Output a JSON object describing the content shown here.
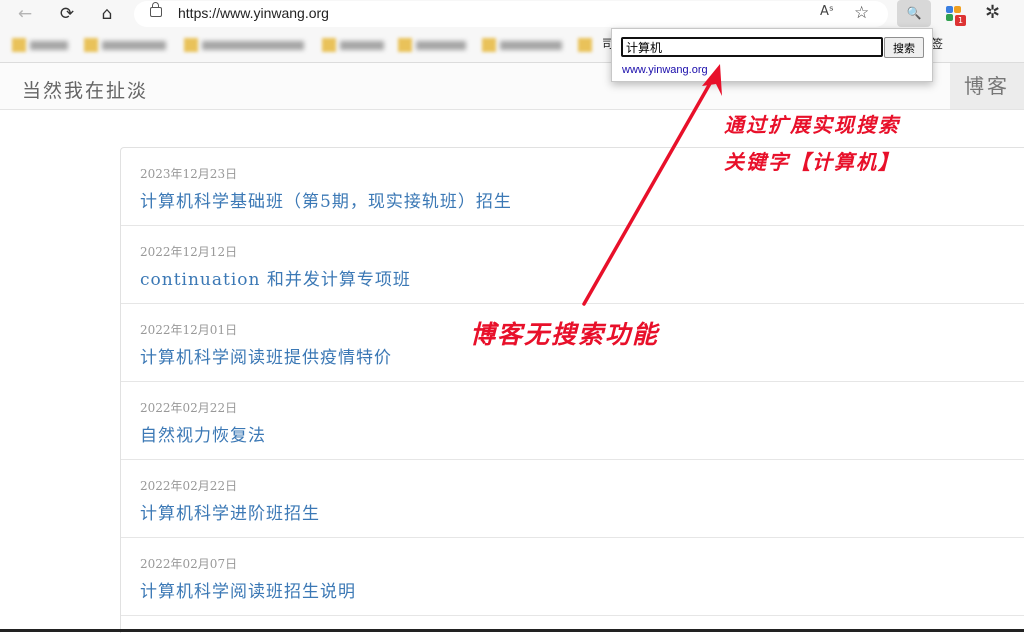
{
  "browser": {
    "url": "https://www.yinwang.org",
    "back_icon": "←",
    "refresh_icon": "⟳",
    "home_icon": "⌂",
    "read_aloud_icon": "Aˢ",
    "favorite_icon": "☆",
    "extension_badge_count": "1",
    "extensions_icon": "✲",
    "search_ext_icon": "🔍",
    "bookmark_tail_1": "司",
    "bookmark_tail_2": "签"
  },
  "search_popup": {
    "input_value": "计算机",
    "button_label": "搜索",
    "result_link": "www.yinwang.org"
  },
  "site": {
    "title": "当然我在扯淡",
    "tab_blog": "博客"
  },
  "posts": [
    {
      "date": "2023年12月23日",
      "title": "计算机科学基础班（第5期，现实接轨班）招生"
    },
    {
      "date": "2022年12月12日",
      "title": "continuation 和并发计算专项班"
    },
    {
      "date": "2022年12月01日",
      "title": "计算机科学阅读班提供疫情特价"
    },
    {
      "date": "2022年02月22日",
      "title": "自然视力恢复法"
    },
    {
      "date": "2022年02月22日",
      "title": "计算机科学进阶班招生"
    },
    {
      "date": "2022年02月07日",
      "title": "计算机科学阅读班招生说明"
    }
  ],
  "annotations": {
    "line1": "通过扩展实现搜索",
    "line2": "关键字【计算机】",
    "center": "博客无搜索功能",
    "color": "#e8102a"
  }
}
